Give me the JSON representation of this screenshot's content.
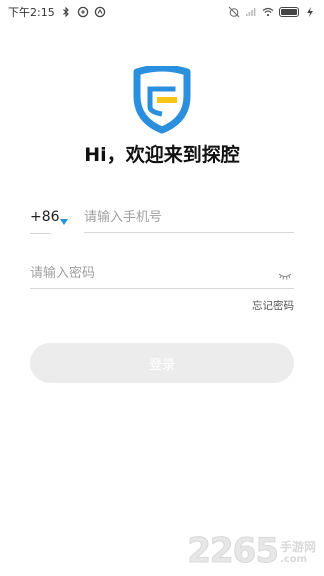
{
  "status_bar": {
    "time": "下午2:15",
    "left_icons": [
      "bluetooth-icon",
      "sync-icon",
      "vpn-icon"
    ],
    "right_icons": [
      "alarm-off-icon",
      "signal-icon",
      "wifi-icon",
      "battery-icon",
      "charging-icon"
    ]
  },
  "app": {
    "logo": "shield-logo",
    "brand_colors": {
      "shield_blue": "#2a8fdc",
      "accent_yellow": "#f5c518"
    },
    "greeting": "Hi，欢迎来到探腔"
  },
  "form": {
    "country_code": "+86",
    "phone_placeholder": "请输入手机号",
    "password_placeholder": "请输入密码",
    "forgot_password": "忘记密码",
    "login_label": "登录"
  },
  "watermark": {
    "digits": "2265",
    "site": "手游网",
    "domain": ".com"
  },
  "colors": {
    "caret": "#2a8fdc",
    "button_bg": "#ececec",
    "divider": "#d6d6d6",
    "placeholder": "#a0a0a0"
  }
}
